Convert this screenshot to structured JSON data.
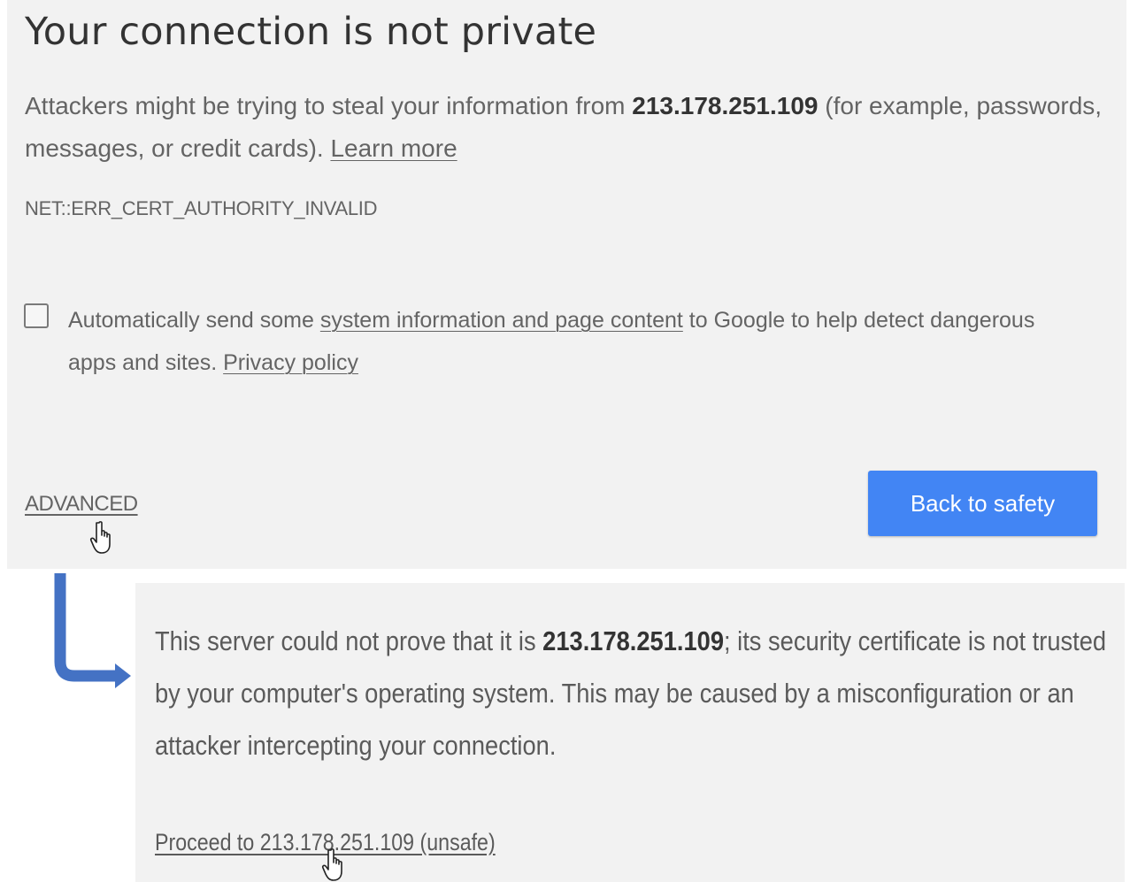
{
  "interstitial": {
    "heading": "Your connection is not private",
    "intro_prefix": "Attackers might be trying to steal your information from ",
    "host": "213.178.251.109",
    "intro_suffix": " (for example, passwords, messages, or credit cards). ",
    "learn_more_label": "Learn more",
    "error_code": "NET::ERR_CERT_AUTHORITY_INVALID",
    "optin_checked": false,
    "optin_prefix": "Automatically send some ",
    "optin_link_label": "system information and page content",
    "optin_middle": " to Google to help detect dangerous apps and sites. ",
    "privacy_link_label": "Privacy policy",
    "advanced_label": "ADVANCED",
    "back_button_label": "Back to safety"
  },
  "details": {
    "text_prefix": "This server could not prove that it is ",
    "host": "213.178.251.109",
    "text_suffix": "; its security certificate is not trusted by your computer's operating system. This may be caused by a misconfiguration or an attacker intercepting your connection.",
    "proceed_label": "Proceed to 213.178.251.109 (unsafe)"
  },
  "colors": {
    "button_blue": "#4285f4",
    "panel_background": "#f2f2f2",
    "arrow_blue": "#4472c4"
  },
  "icons": [
    "hand-pointer-cursor-icon",
    "down-right-arrow-icon"
  ]
}
